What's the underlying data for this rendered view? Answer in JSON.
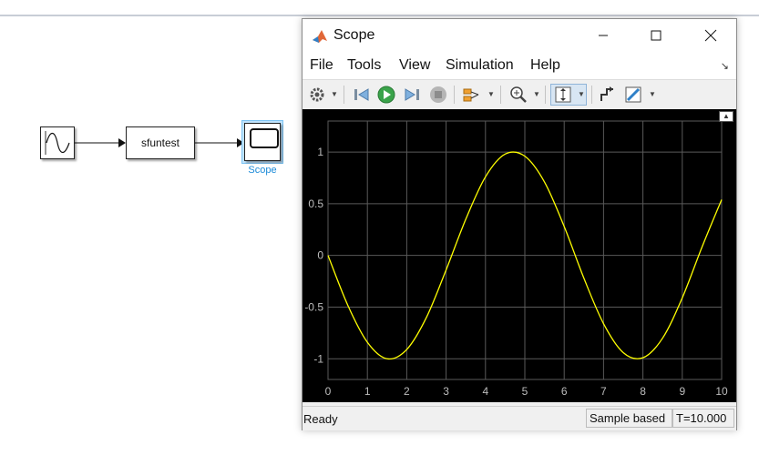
{
  "canvas": {
    "sfun_block_label": "sfuntest",
    "scope_block_label": "Scope"
  },
  "scope_window": {
    "title": "Scope",
    "menu": [
      "File",
      "Tools",
      "View",
      "Simulation",
      "Help"
    ],
    "toolbar_icons": [
      "gear-icon",
      "step-back-icon",
      "run-icon",
      "step-forward-icon",
      "stop-icon",
      "signal-select-icon",
      "zoom-in-icon",
      "scale-axes-icon",
      "highlight-block-icon",
      "measure-icon"
    ],
    "status": {
      "left": "Ready",
      "mode": "Sample based",
      "time": "T=10.000"
    }
  },
  "colors": {
    "plot_background": "#000000",
    "trace": "#ffff00",
    "grid": "#5a5a5a",
    "tick_label": "#bdbdbd"
  },
  "chart_data": {
    "type": "line",
    "x_ticks": [
      "0",
      "1",
      "2",
      "3",
      "4",
      "5",
      "6",
      "7",
      "8",
      "9",
      "10"
    ],
    "y_ticks": [
      "1",
      "0.5",
      "0",
      "-0.5",
      "-1"
    ],
    "xlim": [
      0,
      10
    ],
    "ylim": [
      -1.2,
      1.3
    ],
    "grid": true,
    "series": [
      {
        "x": [
          0,
          0.5,
          1,
          1.5,
          2,
          2.5,
          3,
          3.5,
          4,
          4.5,
          5,
          5.5,
          6,
          6.5,
          7,
          7.5,
          8,
          8.5,
          9,
          9.5,
          10
        ],
        "values": [
          0,
          -0.48,
          -0.84,
          -1.0,
          -0.91,
          -0.6,
          -0.14,
          0.35,
          0.76,
          0.98,
          0.96,
          0.71,
          0.28,
          -0.22,
          -0.66,
          -0.94,
          -0.99,
          -0.8,
          -0.41,
          0.08,
          0.54
        ]
      }
    ]
  }
}
